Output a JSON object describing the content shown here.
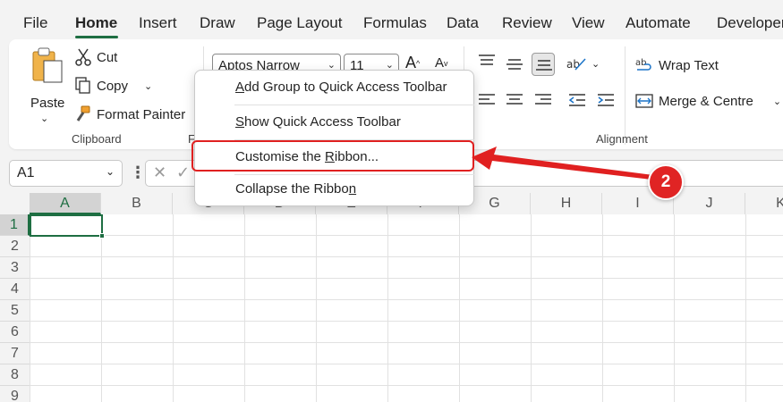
{
  "menu": {
    "file": "File",
    "home": "Home",
    "insert": "Insert",
    "draw": "Draw",
    "page_layout": "Page Layout",
    "formulas": "Formulas",
    "data": "Data",
    "review": "Review",
    "view": "View",
    "automate": "Automate",
    "developer": "Developer"
  },
  "clipboard": {
    "paste": "Paste",
    "cut": "Cut",
    "copy": "Copy",
    "format_painter": "Format Painter",
    "group_label": "Clipboard"
  },
  "font": {
    "family": "Aptos Narrow",
    "size": "11",
    "grow": "A",
    "shrink": "A"
  },
  "alignment": {
    "wrap_text": "Wrap Text",
    "merge_centre": "Merge & Centre",
    "group_label": "Alignment"
  },
  "name_box": {
    "value": "A1"
  },
  "grid": {
    "columns": [
      "A",
      "B",
      "C",
      "D",
      "E",
      "F",
      "G",
      "H",
      "I",
      "J",
      "K"
    ],
    "rows": [
      "1",
      "2",
      "3",
      "4",
      "5",
      "6",
      "7",
      "8",
      "9"
    ]
  },
  "context_menu": {
    "items": [
      {
        "label": "Add Group to Quick Access Toolbar",
        "mnemonic": "A"
      },
      {
        "label": "Show Quick Access Toolbar",
        "mnemonic": "S"
      },
      {
        "label": "Customise the Ribbon...",
        "mnemonic": "R"
      },
      {
        "label": "Collapse the Ribbon",
        "mnemonic": "n"
      }
    ]
  },
  "annotation": {
    "step": "2",
    "color": "#e02020"
  },
  "colors": {
    "accent": "#1e6e42",
    "highlight": "#e02020"
  }
}
